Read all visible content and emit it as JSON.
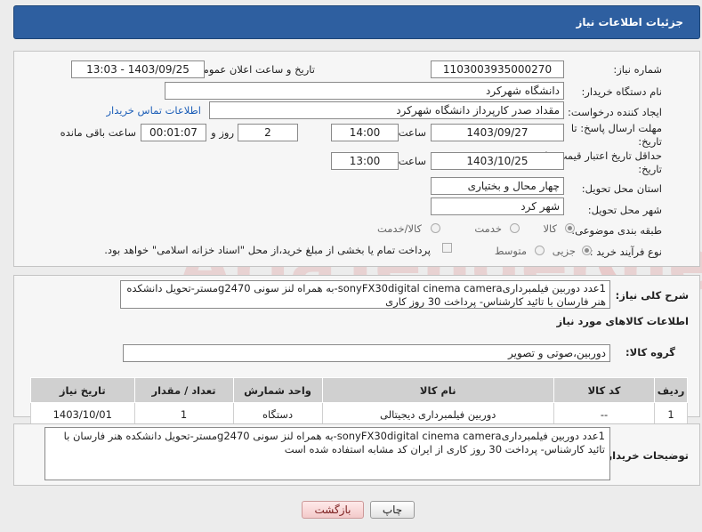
{
  "header": {
    "title": "جزئیات اطلاعات نیاز"
  },
  "fields": {
    "need_number_label": "شماره نیاز:",
    "need_number": "1103003935000270",
    "announce_label": "تاریخ و ساعت اعلان عمومی:",
    "announce_value": "1403/09/25 - 13:03",
    "buyer_org_label": "نام دستگاه خریدار:",
    "buyer_org": "دانشگاه شهرکرد",
    "creator_label": "ایجاد کننده درخواست:",
    "creator": "مقداد صدر کارپرداز دانشگاه شهرکرد",
    "contact_link": "اطلاعات تماس خریدار",
    "deadline_label_1": "مهلت ارسال پاسخ: تا",
    "deadline_label_2": "تاریخ:",
    "deadline_date": "1403/09/27",
    "time_label": "ساعت",
    "deadline_time": "14:00",
    "days_value": "2",
    "days_label": "روز و",
    "remaining_time": "00:01:07",
    "remaining_label": "ساعت باقی مانده",
    "validity_label_1": "حداقل تاریخ اعتبار قیمت: تا",
    "validity_label_2": "تاریخ:",
    "validity_date": "1403/10/25",
    "validity_time_label": "ساعت",
    "validity_time": "13:00",
    "province_label": "استان محل تحویل:",
    "province": "چهار محال و بختیاری",
    "city_label": "شهر محل تحویل:",
    "city": "شهر کرد",
    "category_label": "طبقه بندی موضوعی:",
    "category_options": [
      "کالا",
      "خدمت",
      "کالا/خدمت"
    ],
    "process_label": "نوع فرآیند خرید :",
    "process_options": [
      "جزیی",
      "متوسط"
    ],
    "payment_note": "پرداخت تمام یا بخشی از مبلغ خرید،از محل \"اسناد خزانه اسلامی\" خواهد بود."
  },
  "description": {
    "label": "شرح کلی نیاز:",
    "text": "1عدد دوربین فیلمبرداریsonyFX30digital cinema camera-به همراه لنز سونی g2470مستر-تحویل دانشکده هنر فارسان با تائید کارشناس- پرداخت 30 روز کاری"
  },
  "goods": {
    "section_title": "اطلاعات کالاهای مورد نیاز",
    "group_label": "گروه کالا:",
    "group_value": "دوربین،صوتی و تصویر",
    "columns": [
      "ردیف",
      "کد کالا",
      "نام کالا",
      "واحد شمارش",
      "تعداد / مقدار",
      "تاریخ نیاز"
    ],
    "rows": [
      {
        "row": "1",
        "code": "--",
        "name": "دوربین فیلمبرداری دیجیتالی",
        "unit": "دستگاه",
        "qty": "1",
        "date": "1403/10/01"
      }
    ]
  },
  "buyer_notes": {
    "label": "توضیحات خریدار:",
    "text": "1عدد دوربین فیلمبرداریsonyFX30digital cinema camera-به همراه لنز سونی g2470مستر-تحویل دانشکده هنر فارسان با تائید کارشناس- پرداخت 30 روز کاری از ایران کد مشابه استفاده شده است"
  },
  "buttons": {
    "print": "چاپ",
    "back": "بازگشت"
  },
  "watermark": {
    "text": "AriaTender.neT"
  },
  "colors": {
    "header_bg": "#2e5fa0",
    "link": "#1e5fb8",
    "back_button": "#f3caca"
  }
}
